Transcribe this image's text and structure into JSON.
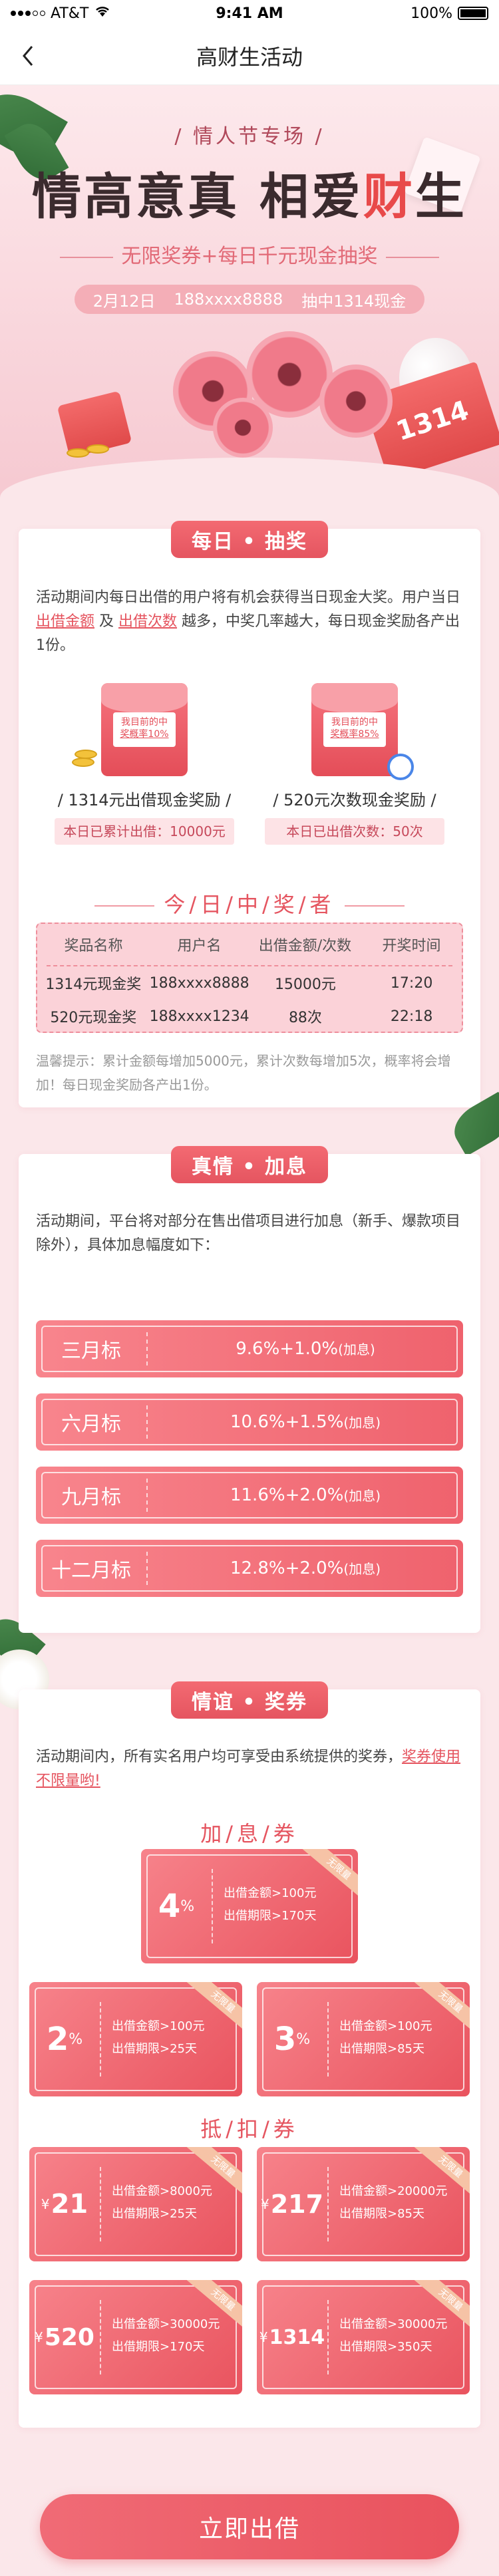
{
  "status": {
    "carrier": "AT&T",
    "time": "9:41 AM",
    "battery": "100%"
  },
  "nav": {
    "title": "高财生活动"
  },
  "hero": {
    "subtitle": "/ 情人节专场 /",
    "title_part1": "情高意真 相爱",
    "title_red": "财",
    "title_part2": "生",
    "tagline": "无限奖券+每日千元现金抽奖",
    "info": [
      "2月12日",
      "188xxxx8888",
      "抽中1314现金"
    ],
    "envelope_text": "1314"
  },
  "lottery": {
    "tab": "每日 • 抽奖",
    "desc_before_link1": "活动期间内每日出借的用户将有机会获得当日现金大奖。用户当日",
    "link1": "出借金额",
    "desc_mid": " 及 ",
    "link2": "出借次数",
    "desc_after": " 越多，中奖几率越大，每日现金奖励各产出1份。",
    "awards": [
      {
        "note_line1": "我目前的中",
        "note_line2": "奖概率10%",
        "title": "/ 1314元出借现金奖励 /",
        "stat": "本日已累计出借：10000元"
      },
      {
        "note_line1": "我目前的中",
        "note_line2": "奖概率85%",
        "title": "/ 520元次数现金奖励 /",
        "stat": "本日已出借次数：50次"
      }
    ],
    "winners_title": "今/日/中/奖/者",
    "winners_headers": [
      "奖品名称",
      "用户名",
      "出借金额/次数",
      "开奖时间"
    ],
    "winners_rows": [
      [
        "1314元现金奖",
        "188xxxx8888",
        "15000元",
        "17:20"
      ],
      [
        "520元现金奖",
        "188xxxx1234",
        "88次",
        "22:18"
      ]
    ],
    "tip": "温馨提示：累计金额每增加5000元，累计次数每增加5次，概率将会增加！每日现金奖励各产出1份。"
  },
  "rates": {
    "tab": "真情 • 加息",
    "desc": "活动期间，平台将对部分在售出借项目进行加息（新手、爆款项目除外），具体加息幅度如下：",
    "items": [
      {
        "label": "三月标",
        "value": "9.6%+1.0%",
        "suffix": "(加息)"
      },
      {
        "label": "六月标",
        "value": "10.6%+1.5%",
        "suffix": "(加息)"
      },
      {
        "label": "九月标",
        "value": "11.6%+2.0%",
        "suffix": "(加息)"
      },
      {
        "label": "十二月标",
        "value": "12.8%+2.0%",
        "suffix": "(加息)"
      }
    ]
  },
  "coupons": {
    "tab": "情谊 • 奖券",
    "desc_before_link": "活动期间内，所有实名用户均可享受由系统提供的奖券，",
    "link": "奖券使用不限量哟!",
    "interest_title": "加/息/券",
    "interest": [
      {
        "num": "4",
        "unit": "%",
        "line1": "出借金额>100元",
        "line2": "出借期限>170天",
        "ribbon": "无限量"
      },
      {
        "num": "2",
        "unit": "%",
        "line1": "出借金额>100元",
        "line2": "出借期限>25天",
        "ribbon": "无限量"
      },
      {
        "num": "3",
        "unit": "%",
        "line1": "出借金额>100元",
        "line2": "出借期限>85天",
        "ribbon": "无限量"
      }
    ],
    "deduct_title": "抵/扣/券",
    "deduct": [
      {
        "yen": "¥",
        "num": "21",
        "line1": "出借金额>8000元",
        "line2": "出借期限>25天",
        "ribbon": "无限量"
      },
      {
        "yen": "¥",
        "num": "217",
        "line1": "出借金额>20000元",
        "line2": "出借期限>85天",
        "ribbon": "无限量"
      },
      {
        "yen": "¥",
        "num": "520",
        "line1": "出借金额>30000元",
        "line2": "出借期限>170天",
        "ribbon": "无限量"
      },
      {
        "yen": "¥",
        "num": "1314",
        "line1": "出借金额>30000元",
        "line2": "出借期限>350天",
        "ribbon": "无限量"
      }
    ]
  },
  "cta": {
    "label": "立即出借"
  },
  "colors": {
    "accent": "#e9535e",
    "page_bg": "#fbe7ea",
    "link": "#e5535e"
  }
}
